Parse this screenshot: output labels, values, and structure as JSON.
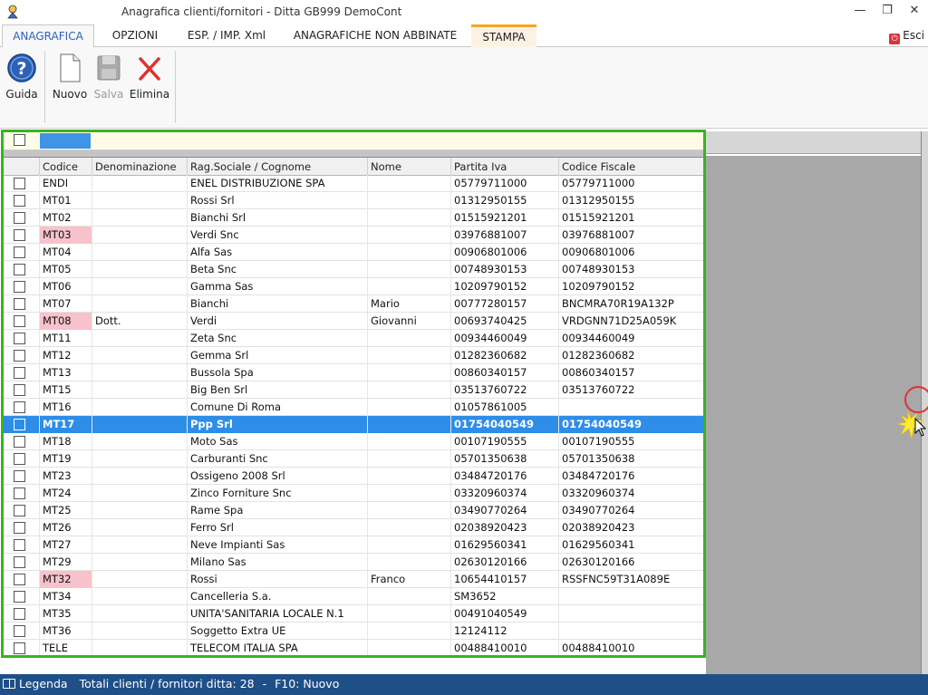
{
  "window": {
    "title": "Anagrafica clienti/fornitori - Ditta GB999 DemoCont",
    "minimize_icon": "minimize-icon",
    "restore_icon": "restore-icon",
    "close_icon": "close-icon"
  },
  "tabs": [
    {
      "label": "ANAGRAFICA",
      "active": true
    },
    {
      "label": "OPZIONI"
    },
    {
      "label": "ESP. / IMP. Xml"
    },
    {
      "label": "ANAGRAFICHE NON ABBINATE"
    },
    {
      "label": "STAMPA"
    }
  ],
  "esci_label": "Esci",
  "toolbar": {
    "guida": "Guida",
    "nuovo": "Nuovo",
    "salva": "Salva",
    "elimina": "Elimina"
  },
  "columns": [
    "Codice",
    "Denominazione",
    "Rag.Sociale / Cognome",
    "Nome",
    "Partita Iva",
    "Codice Fiscale"
  ],
  "rows": [
    {
      "codice": "ENDI",
      "denominazione": "",
      "ragsoc": "ENEL DISTRIBUZIONE SPA",
      "nome": "",
      "piva": "05779711000",
      "cf": "05779711000"
    },
    {
      "codice": "MT01",
      "denominazione": "",
      "ragsoc": "Rossi Srl",
      "nome": "",
      "piva": "01312950155",
      "cf": "01312950155"
    },
    {
      "codice": "MT02",
      "denominazione": "",
      "ragsoc": "Bianchi Srl",
      "nome": "",
      "piva": "01515921201",
      "cf": "01515921201"
    },
    {
      "codice": "MT03",
      "denominazione": "",
      "ragsoc": "Verdi Snc",
      "nome": "",
      "piva": "03976881007",
      "cf": "03976881007",
      "highlight": true
    },
    {
      "codice": "MT04",
      "denominazione": "",
      "ragsoc": "Alfa Sas",
      "nome": "",
      "piva": "00906801006",
      "cf": "00906801006"
    },
    {
      "codice": "MT05",
      "denominazione": "",
      "ragsoc": "Beta Snc",
      "nome": "",
      "piva": "00748930153",
      "cf": "00748930153"
    },
    {
      "codice": "MT06",
      "denominazione": "",
      "ragsoc": "Gamma Sas",
      "nome": "",
      "piva": "10209790152",
      "cf": "10209790152"
    },
    {
      "codice": "MT07",
      "denominazione": "",
      "ragsoc": "Bianchi",
      "nome": "Mario",
      "piva": "00777280157",
      "cf": "BNCMRA70R19A132P"
    },
    {
      "codice": "MT08",
      "denominazione": "Dott.",
      "ragsoc": "Verdi",
      "nome": "Giovanni",
      "piva": "00693740425",
      "cf": "VRDGNN71D25A059K",
      "highlight": true
    },
    {
      "codice": "MT11",
      "denominazione": "",
      "ragsoc": "Zeta Snc",
      "nome": "",
      "piva": "00934460049",
      "cf": "00934460049"
    },
    {
      "codice": "MT12",
      "denominazione": "",
      "ragsoc": "Gemma Srl",
      "nome": "",
      "piva": "01282360682",
      "cf": "01282360682"
    },
    {
      "codice": "MT13",
      "denominazione": "",
      "ragsoc": "Bussola Spa",
      "nome": "",
      "piva": "00860340157",
      "cf": "00860340157"
    },
    {
      "codice": "MT15",
      "denominazione": "",
      "ragsoc": "Big Ben Srl",
      "nome": "",
      "piva": "03513760722",
      "cf": "03513760722"
    },
    {
      "codice": "MT16",
      "denominazione": "",
      "ragsoc": "Comune Di Roma",
      "nome": "",
      "piva": "01057861005",
      "cf": ""
    },
    {
      "codice": "MT17",
      "denominazione": "",
      "ragsoc": "Ppp Srl",
      "nome": "",
      "piva": "01754040549",
      "cf": "01754040549",
      "selected": true
    },
    {
      "codice": "MT18",
      "denominazione": "",
      "ragsoc": "Moto Sas",
      "nome": "",
      "piva": "00107190555",
      "cf": "00107190555"
    },
    {
      "codice": "MT19",
      "denominazione": "",
      "ragsoc": "Carburanti Snc",
      "nome": "",
      "piva": "05701350638",
      "cf": "05701350638"
    },
    {
      "codice": "MT23",
      "denominazione": "",
      "ragsoc": "Ossigeno 2008 Srl",
      "nome": "",
      "piva": "03484720176",
      "cf": "03484720176"
    },
    {
      "codice": "MT24",
      "denominazione": "",
      "ragsoc": "Zinco Forniture Snc",
      "nome": "",
      "piva": "03320960374",
      "cf": "03320960374"
    },
    {
      "codice": "MT25",
      "denominazione": "",
      "ragsoc": "Rame Spa",
      "nome": "",
      "piva": "03490770264",
      "cf": "03490770264"
    },
    {
      "codice": "MT26",
      "denominazione": "",
      "ragsoc": "Ferro Srl",
      "nome": "",
      "piva": "02038920423",
      "cf": "02038920423"
    },
    {
      "codice": "MT27",
      "denominazione": "",
      "ragsoc": "Neve Impianti Sas",
      "nome": "",
      "piva": "01629560341",
      "cf": "01629560341"
    },
    {
      "codice": "MT29",
      "denominazione": "",
      "ragsoc": "Milano Sas",
      "nome": "",
      "piva": "02630120166",
      "cf": "02630120166"
    },
    {
      "codice": "MT32",
      "denominazione": "",
      "ragsoc": "Rossi",
      "nome": "Franco",
      "piva": "10654410157",
      "cf": "RSSFNC59T31A089E",
      "highlight": true
    },
    {
      "codice": "MT34",
      "denominazione": "",
      "ragsoc": "Cancelleria S.a.",
      "nome": "",
      "piva": "SM3652",
      "cf": ""
    },
    {
      "codice": "MT35",
      "denominazione": "",
      "ragsoc": "UNITA'SANITARIA LOCALE N.1",
      "nome": "",
      "piva": "00491040549",
      "cf": ""
    },
    {
      "codice": "MT36",
      "denominazione": "",
      "ragsoc": "Soggetto Extra UE",
      "nome": "",
      "piva": "12124112",
      "cf": ""
    },
    {
      "codice": "TELE",
      "denominazione": "",
      "ragsoc": "TELECOM ITALIA SPA",
      "nome": "",
      "piva": "00488410010",
      "cf": "00488410010"
    }
  ],
  "status": {
    "legenda": "Legenda",
    "totali": "Totali clienti / fornitori ditta: 28",
    "separator": "-",
    "shortcut": "F10: Nuovo"
  },
  "colors": {
    "accent": "#2e8de6",
    "frame": "#36b51f",
    "highlight": "#f8c2cc",
    "statusbar": "#1f4f87"
  }
}
